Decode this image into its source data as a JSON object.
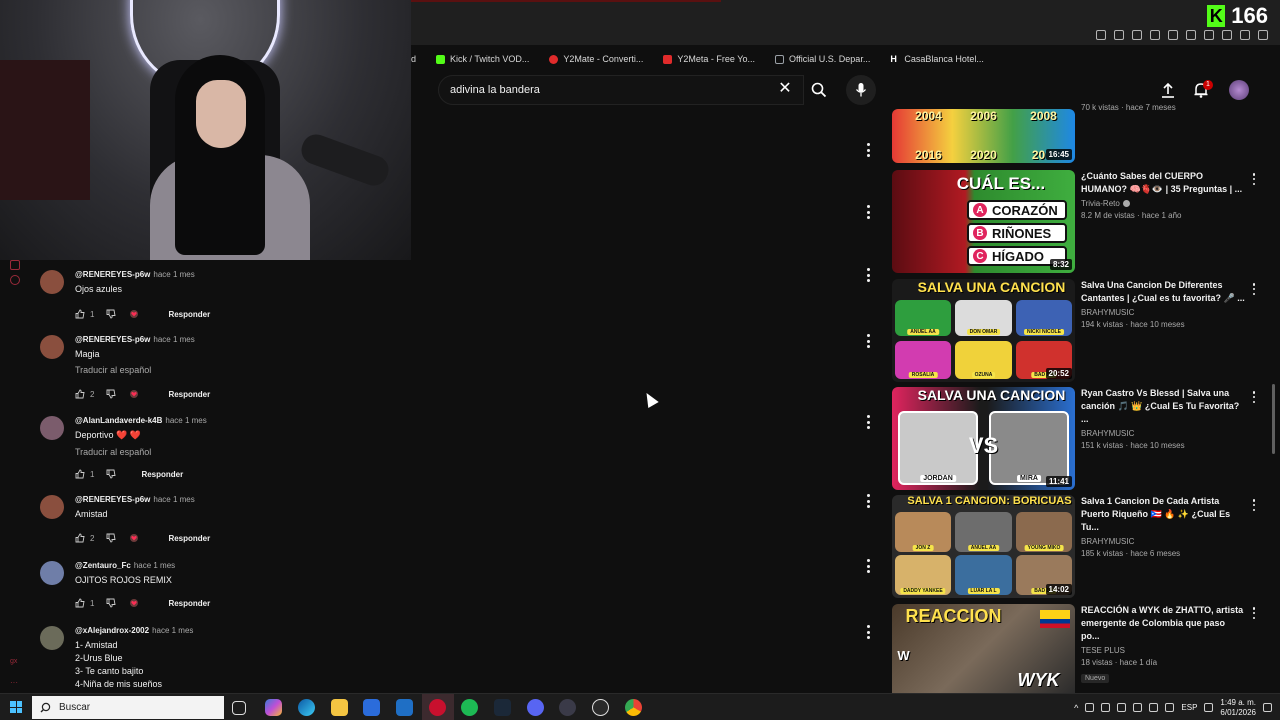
{
  "stream": {
    "viewer_count": "166",
    "kick_logo_letter": "K"
  },
  "browser": {
    "bookmarks": [
      {
        "label": "d",
        "color": ""
      },
      {
        "label": "Kick / Twitch VOD...",
        "color": "#53fc18"
      },
      {
        "label": "Y2Mate - Converti...",
        "color": "#e02b2b"
      },
      {
        "label": "Y2Meta - Free Yo...",
        "color": "#e02b2b"
      },
      {
        "label": "Official U.S. Depar...",
        "color": "#9aa0a6"
      },
      {
        "label": "CasaBlanca Hotel...",
        "color": "#ffffff"
      }
    ]
  },
  "youtube": {
    "search_value": "adivina la bandera",
    "notification_count": "1"
  },
  "comments": [
    {
      "author": "@RENEREYES-p6w",
      "time": "hace 1 mes",
      "text": [
        "Ojos azules"
      ],
      "translate": "",
      "likes": "1",
      "reply": "Responder",
      "heart": true,
      "avatar_color": "#8a4f3e"
    },
    {
      "author": "@RENEREYES-p6w",
      "time": "hace 1 mes",
      "text": [
        "Magia"
      ],
      "translate": "Traducir al español",
      "likes": "2",
      "reply": "Responder",
      "heart": true,
      "avatar_color": "#8a4f3e"
    },
    {
      "author": "@AlanLandaverde-k4B",
      "time": "hace 1 mes",
      "text": [
        "Deportivo ❤️ ❤️"
      ],
      "translate": "Traducir al español",
      "likes": "1",
      "reply": "Responder",
      "heart": false,
      "avatar_color": "#7b5c6c"
    },
    {
      "author": "@RENEREYES-p6w",
      "time": "hace 1 mes",
      "text": [
        "Amistad"
      ],
      "translate": "",
      "likes": "2",
      "reply": "Responder",
      "heart": true,
      "avatar_color": "#8a4f3e"
    },
    {
      "author": "@Zentauro_Fc",
      "time": "hace 1 mes",
      "text": [
        "OJITOS ROJOS REMIX"
      ],
      "translate": "",
      "likes": "1",
      "reply": "Responder",
      "heart": true,
      "avatar_color": "#6f7ea8"
    },
    {
      "author": "@xAlejandrox-2002",
      "time": "hace 1 mes",
      "text": [
        "1- Amistad",
        "2-Urus Blue",
        "3- Te canto bajito",
        "4-Niña de mis sueños"
      ],
      "translate": "",
      "likes": "",
      "reply": "",
      "heart": false,
      "avatar_color": "#6b6b5a"
    }
  ],
  "results": [
    {
      "title": "",
      "channel": "",
      "meta": "70 k vistas · hace 7 meses",
      "duration": "16:45",
      "thumb_text": [
        "2004",
        "2006",
        "2008",
        "2016",
        "2020",
        "20"
      ],
      "verified": false,
      "badge": ""
    },
    {
      "title": "¿Cuánto Sabes del CUERPO HUMANO? 🧠🫀👁️ | 35 Preguntas | ...",
      "channel": "Trivia-Reto",
      "meta": "8.2 M de vistas · hace 1 año",
      "duration": "8:32",
      "thumb_text": [
        "CUÁL ES...",
        "CORAZÓN",
        "RIÑONES",
        "HÍGADO"
      ],
      "verified": true,
      "badge": ""
    },
    {
      "title": "Salva Una Cancion De Diferentes Cantantes | ¿Cual es tu favorita? 🎤 ...",
      "channel": "BRAHYMUSIC",
      "meta": "194 k vistas · hace 10 meses",
      "duration": "20:52",
      "thumb_text": [
        "SALVA UNA CANCION",
        "ANUEL AA",
        "DON OMAR",
        "NICKI NICOLE",
        "ROSALIA",
        "OZUNA",
        "BAD BU"
      ],
      "verified": false,
      "badge": ""
    },
    {
      "title": "Ryan Castro Vs Blessd | Salva una canción 🎵 👑 ¿Cual Es Tu Favorita? ...",
      "channel": "BRAHYMUSIC",
      "meta": "151 k vistas · hace 10 meses",
      "duration": "11:41",
      "thumb_text": [
        "SALVA UNA CANCION",
        "JORDAN",
        "MIRA"
      ],
      "verified": false,
      "badge": ""
    },
    {
      "title": "Salva 1 Cancion De Cada Artista Puerto Riqueño 🇵🇷 🔥 ✨ ¿Cual Es Tu...",
      "channel": "BRAHYMUSIC",
      "meta": "185 k vistas · hace 6 meses",
      "duration": "14:02",
      "thumb_text": [
        "SALVA 1 CANCION: BORICUAS",
        "JON Z",
        "ANUEL AA",
        "YOUNG MIKO",
        "DADDY YANKEE",
        "LUAR LA L",
        "BAD BU"
      ],
      "verified": false,
      "badge": ""
    },
    {
      "title": "REACCIÓN a WYK de ZHATTO, artista emergente de Colombia que paso po...",
      "channel": "TESE PLUS",
      "meta": "18 vistas · hace 1 día",
      "duration": "",
      "thumb_text": [
        "REACCION",
        "W",
        "WYK"
      ],
      "verified": false,
      "badge": "Nuevo"
    }
  ],
  "taskbar": {
    "search_placeholder": "Buscar",
    "language": "ESP",
    "time": "1:49 a. m.",
    "date": "6/01/2026"
  }
}
